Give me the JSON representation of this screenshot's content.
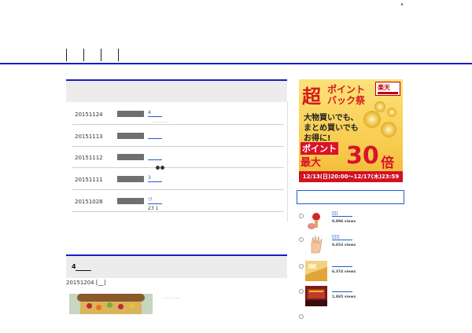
{
  "header": {
    "top_mark": "▸"
  },
  "news": {
    "items": [
      {
        "date": "20151124",
        "title": "4",
        "sub": "........"
      },
      {
        "date": "20151113",
        "title": "",
        "sub": ""
      },
      {
        "date": "20151112",
        "title": "",
        "sub": ""
      },
      {
        "date": "20151111",
        "title": "3",
        "sub": ""
      },
      {
        "date": "20151028",
        "title": "!?",
        "sub": "23 1"
      }
    ]
  },
  "section2": {
    "title": "4",
    "date": "20151204 [__]",
    "snippet": "........"
  },
  "ad": {
    "cho": "超",
    "line1": "ポイント",
    "line2": "バック祭",
    "logo": "楽天",
    "body1": "大物買いでも、",
    "body2": "まとめ買いでも",
    "body3": "お得に!",
    "points": "ポイント",
    "max": "最大",
    "num": "30",
    "bai": "倍",
    "period": "12/13(日)20:00～12/17(木)23:59"
  },
  "ranking": [
    {
      "title": "[[[[",
      "views": "9,896 views"
    },
    {
      "title": "[[[[[",
      "views": "8,653 views"
    },
    {
      "title": "",
      "views": "6,374 views"
    },
    {
      "title": "",
      "views": "1,865 views"
    }
  ]
}
